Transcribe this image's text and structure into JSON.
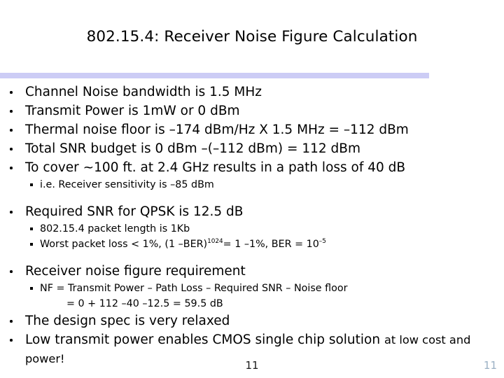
{
  "slide": {
    "title": "802.15.4: Receiver Noise Figure Calculation",
    "accent_color": "#ccccf5",
    "page_number_center": "11",
    "page_number_right": "11",
    "page_number_right_color": "#9bb0c4"
  },
  "bullets": {
    "b1": "Channel Noise bandwidth is 1.5 MHz",
    "b2": "Transmit Power is 1mW or 0 dBm",
    "b3": "Thermal noise floor is –174 dBm/Hz X 1.5 MHz = –112 dBm",
    "b4": "Total SNR budget is 0 dBm –(–112 dBm) = 112 dBm",
    "b5": "To cover ~100 ft. at 2.4 GHz results in a path loss of 40 dB",
    "b5_sub1": "i.e. Receiver sensitivity is –85 dBm",
    "b6": "Required SNR for QPSK is 12.5 dB",
    "b6_sub1": "802.15.4 packet length is 1Kb",
    "b6_sub2_pre": "Worst packet loss < 1%, (1 –BER)",
    "b6_sub2_sup1": "1024",
    "b6_sub2_mid": "= 1 –1%, BER = 10",
    "b6_sub2_sup2": "–5",
    "b7": "Receiver noise figure requirement",
    "b7_sub1": "NF = Transmit Power – Path Loss – Required SNR – Noise floor",
    "b7_sub2": "= 0 + 112 –40 –12.5 = 59.5 dB",
    "b8": "The design spec is very relaxed",
    "b9_part1": "Low transmit power enables CMOS single chip solution ",
    "b9_part2": "at low cost and power!"
  }
}
